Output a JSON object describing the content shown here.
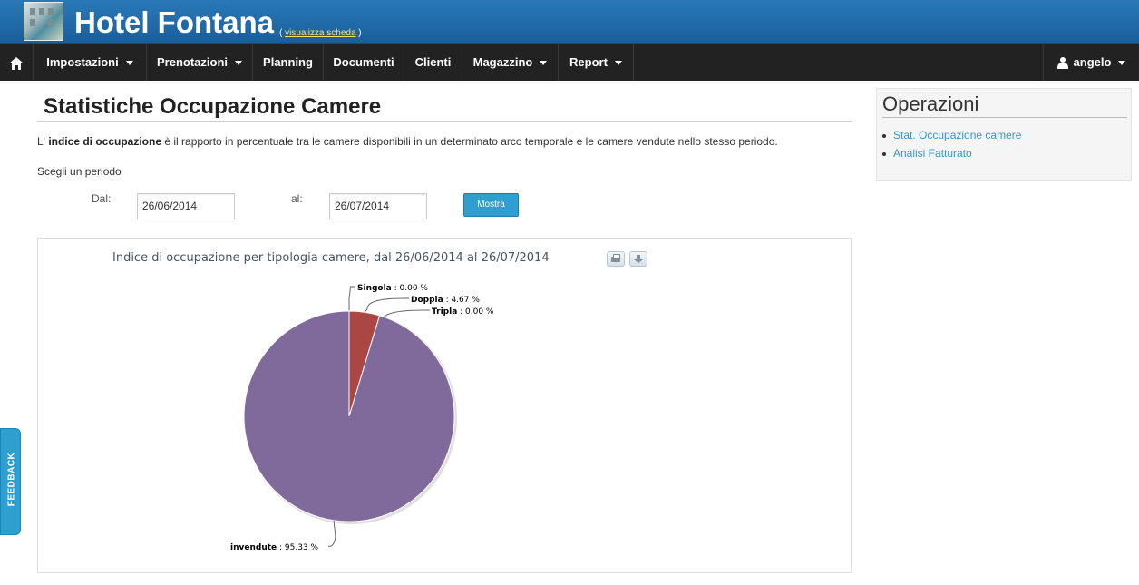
{
  "header": {
    "hotel_name": "Hotel Fontana",
    "view_link_open": "(",
    "view_link_label": "visualizza scheda",
    "view_link_close": ")"
  },
  "navbar": {
    "items": [
      {
        "label": "Impostazioni",
        "has_dropdown": true
      },
      {
        "label": "Prenotazioni",
        "has_dropdown": true
      },
      {
        "label": "Planning",
        "has_dropdown": false
      },
      {
        "label": "Documenti",
        "has_dropdown": false
      },
      {
        "label": "Clienti",
        "has_dropdown": false
      },
      {
        "label": "Magazzino",
        "has_dropdown": true
      },
      {
        "label": "Report",
        "has_dropdown": true
      }
    ],
    "user": {
      "label": "angelo",
      "icon": "user-icon"
    },
    "home_icon": "home-icon"
  },
  "main": {
    "title": "Statistiche Occupazione Camere",
    "intro_prefix": "L'",
    "intro_bold": "indice di occupazione",
    "intro_rest": "è il rapporto in percentuale tra le camere disponibili in un determinato arco temporale e le camere vendute nello stesso periodo.",
    "choose_period": "Scegli un periodo",
    "from_label": "Dal:",
    "from_value": "26/06/2014",
    "to_label": "al:",
    "to_value": "26/07/2014",
    "show_button": "Mostra"
  },
  "chart_data": {
    "type": "pie",
    "title": "Indice di occupazione per tipologia camere, dal 26/06/2014 al 26/07/2014",
    "slices": [
      {
        "name": "Singola",
        "value": 0.0,
        "label": "0.00 %",
        "color": "#4572a7"
      },
      {
        "name": "Doppia",
        "value": 4.67,
        "label": "4.67 %",
        "color": "#aa4643"
      },
      {
        "name": "Tripla",
        "value": 0.0,
        "label": "0.00 %",
        "color": "#89a54e"
      },
      {
        "name": "invendute",
        "value": 95.33,
        "label": "95.33 %",
        "color": "#80699b"
      }
    ]
  },
  "sidebar": {
    "title": "Operazioni",
    "links": [
      "Stat. Occupazione camere",
      "Analisi Fatturato"
    ]
  },
  "feedback": {
    "label": "FEEDBACK"
  },
  "colors": {
    "banner": "#1f6aa8",
    "navbar": "#222222",
    "button": "#2f9fd0",
    "link": "#3399cc"
  }
}
